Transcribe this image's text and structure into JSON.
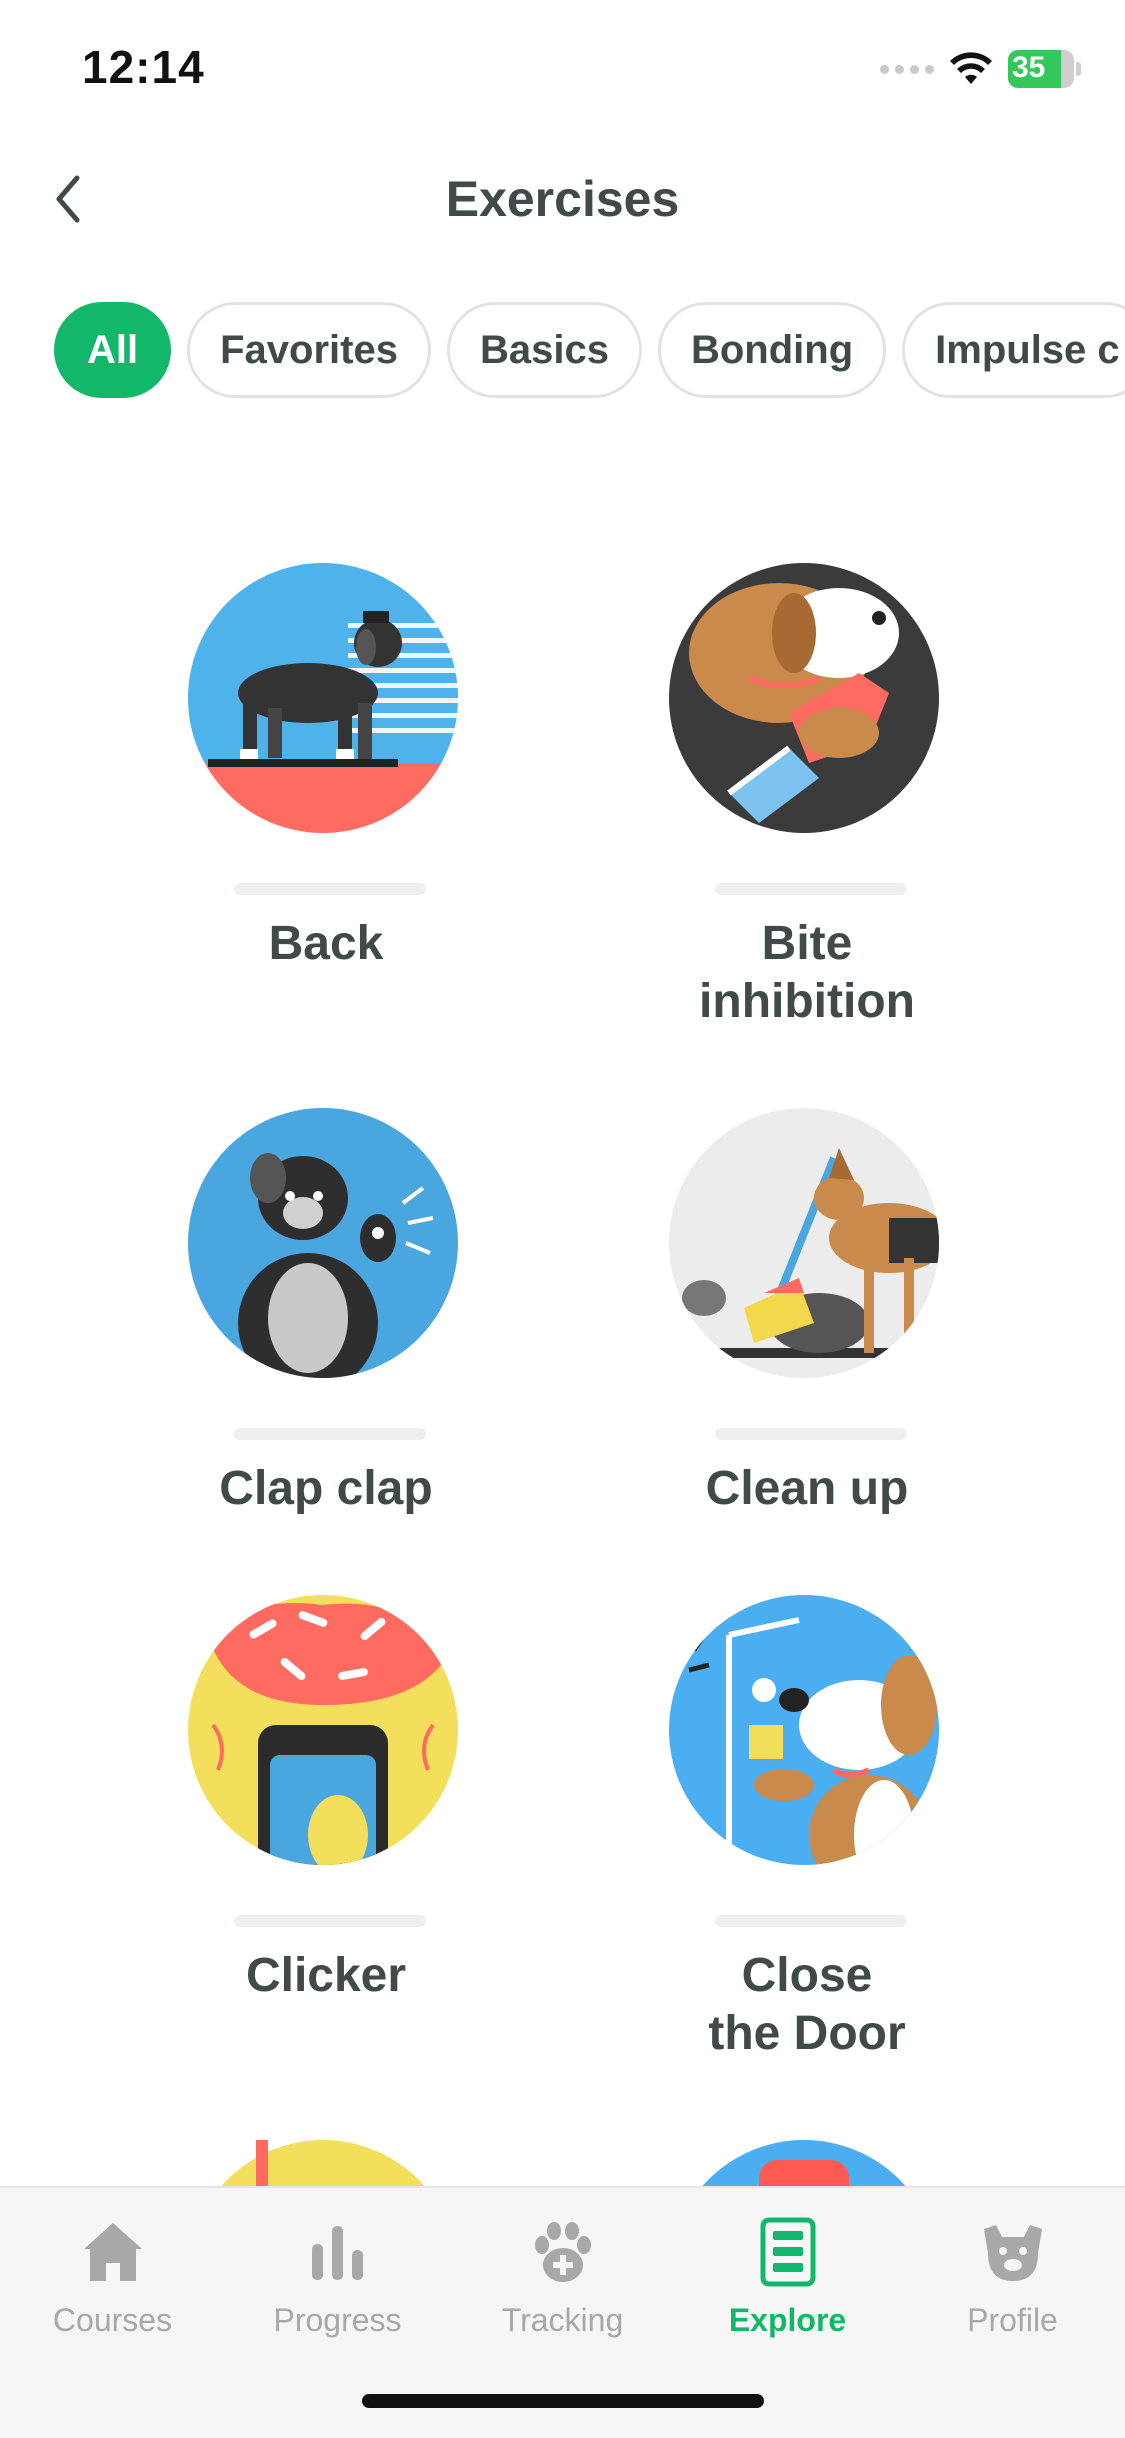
{
  "status_bar": {
    "time": "12:14",
    "battery": "35",
    "battery_level": 0.35
  },
  "header": {
    "title": "Exercises"
  },
  "filters": [
    {
      "label": "All",
      "active": true
    },
    {
      "label": "Favorites",
      "active": false
    },
    {
      "label": "Basics",
      "active": false
    },
    {
      "label": "Bonding",
      "active": false
    },
    {
      "label": "Impulse c",
      "active": false
    }
  ],
  "exercises": [
    {
      "label": "Back",
      "icon": "dog-walking-backward-illustration"
    },
    {
      "label": "Bite\ninhibition",
      "icon": "dog-biting-toy-illustration"
    },
    {
      "label": "Clap clap",
      "icon": "dog-clapping-illustration"
    },
    {
      "label": "Clean up",
      "icon": "dog-cleaning-illustration"
    },
    {
      "label": "Clicker",
      "icon": "clicker-device-illustration"
    },
    {
      "label": "Close\nthe Door",
      "icon": "dog-closing-door-illustration"
    }
  ],
  "tabs": [
    {
      "label": "Courses",
      "icon": "home-icon",
      "active": false
    },
    {
      "label": "Progress",
      "icon": "bar-chart-icon",
      "active": false
    },
    {
      "label": "Tracking",
      "icon": "paw-plus-icon",
      "active": false
    },
    {
      "label": "Explore",
      "icon": "explore-list-icon",
      "active": true
    },
    {
      "label": "Profile",
      "icon": "dog-face-icon",
      "active": false
    }
  ],
  "colors": {
    "accent": "#12b76a",
    "text": "#3f4a49",
    "inactive": "#a8a8a8"
  }
}
